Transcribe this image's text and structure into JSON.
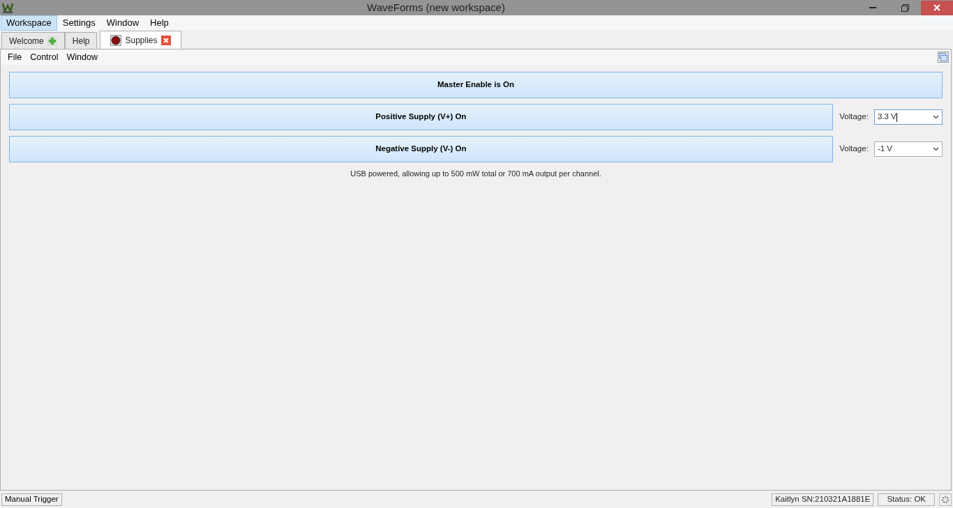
{
  "window": {
    "title": "WaveForms  (new workspace)"
  },
  "menu": [
    {
      "label": "Workspace",
      "selected": true
    },
    {
      "label": "Settings",
      "selected": false
    },
    {
      "label": "Window",
      "selected": false
    },
    {
      "label": "Help",
      "selected": false
    }
  ],
  "tabs": [
    {
      "label": "Welcome",
      "kind": "add",
      "selected": false
    },
    {
      "label": "Help",
      "kind": "plain",
      "selected": false
    },
    {
      "label": "Supplies",
      "kind": "closable",
      "selected": true
    }
  ],
  "submenu": [
    "File",
    "Control",
    "Window"
  ],
  "master": {
    "label": "Master Enable is On"
  },
  "supplies": [
    {
      "label": "Positive Supply (V+) On",
      "voltage_label": "Voltage:",
      "voltage": "3.3 V",
      "focused": true
    },
    {
      "label": "Negative Supply (V-) On",
      "voltage_label": "Voltage:",
      "voltage": "-1 V",
      "focused": false
    }
  ],
  "note": "USB powered, allowing up to 500 mW total or 700 mA output per channel.",
  "status_bar": {
    "trigger": "Manual Trigger",
    "device": "Kaitlyn SN:210321A1881E",
    "status": "Status: OK"
  }
}
